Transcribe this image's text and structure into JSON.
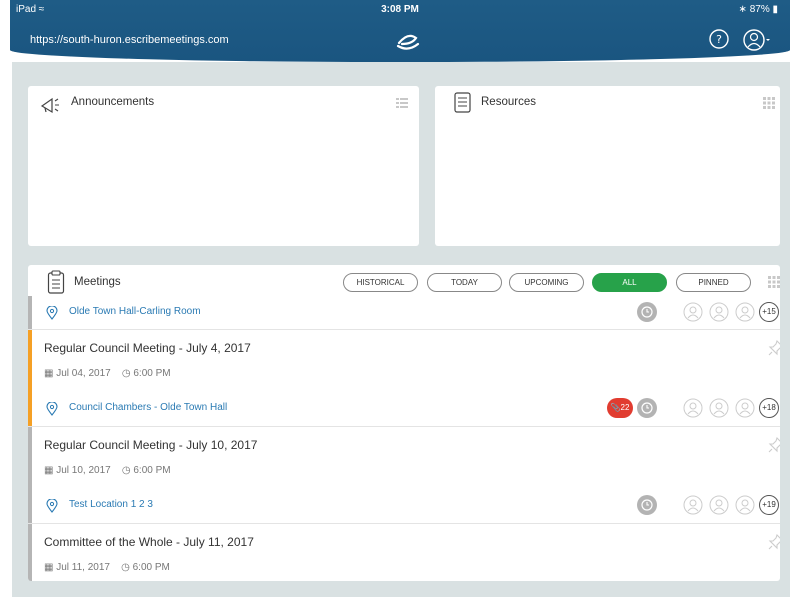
{
  "status_bar": {
    "device": "iPad",
    "time": "3:08 PM",
    "battery": "87%"
  },
  "header": {
    "url": "https://south-huron.escribemeetings.com"
  },
  "announcements": {
    "title": "Announcements"
  },
  "resources": {
    "title": "Resources"
  },
  "meetings": {
    "title": "Meetings",
    "filters": [
      "HISTORICAL",
      "TODAY",
      "UPCOMING",
      "ALL",
      "PINNED"
    ],
    "active_filter": "ALL",
    "items": [
      {
        "location": "Olde Town Hall-Carling Room",
        "attendee_count": "+15"
      },
      {
        "title": "Regular Council Meeting - July 4, 2017",
        "date": "Jul 04, 2017",
        "time": "6:00 PM",
        "location": "Council Chambers - Olde Town Hall",
        "badge": "22",
        "attendee_count": "+18"
      },
      {
        "title": "Regular Council Meeting - July 10, 2017",
        "date": "Jul 10, 2017",
        "time": "6:00 PM",
        "location": "Test Location 1 2 3",
        "attendee_count": "+19"
      },
      {
        "title": "Committee of the Whole - July 11, 2017",
        "date": "Jul 11, 2017",
        "time": "6:00 PM"
      }
    ]
  },
  "colors": {
    "header": "#1f5c86",
    "active_filter": "#27a24a",
    "accent_bar": "#f5a025",
    "link": "#2a7ab3",
    "badge_red": "#e13c30"
  }
}
